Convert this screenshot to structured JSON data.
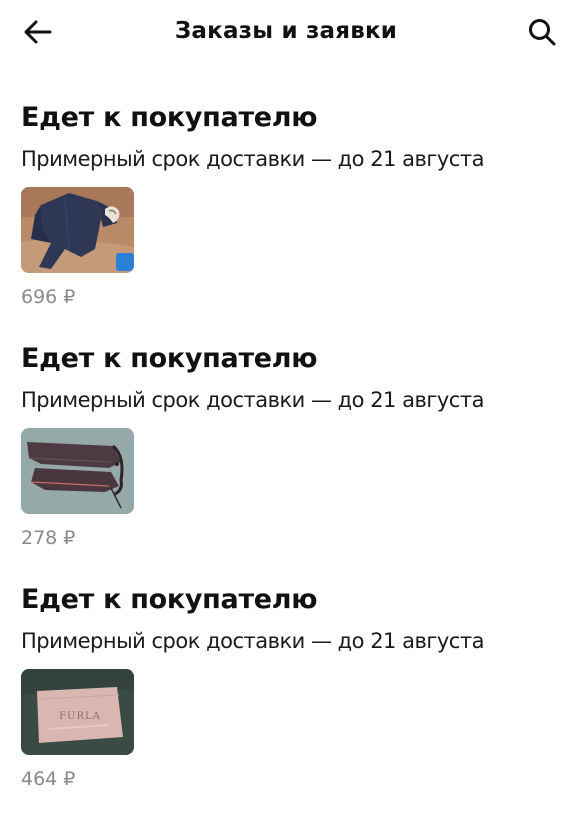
{
  "header": {
    "title": "Заказы и заявки",
    "back_icon": "arrow-left-icon",
    "search_icon": "search-icon"
  },
  "orders": [
    {
      "status": "Едет к покупателю",
      "eta": "Примерный срок доставки — до 21 августа",
      "price": "696 ₽"
    },
    {
      "status": "Едет к покупателю",
      "eta": "Примерный срок доставки — до 21 августа",
      "price": "278 ₽"
    },
    {
      "status": "Едет к покупателю",
      "eta": "Примерный срок доставки — до 21 августа",
      "price": "464 ₽",
      "image_text": "FURLA"
    }
  ],
  "colors": {
    "text": "#111111",
    "price": "#8a8a8a",
    "background": "#ffffff"
  }
}
